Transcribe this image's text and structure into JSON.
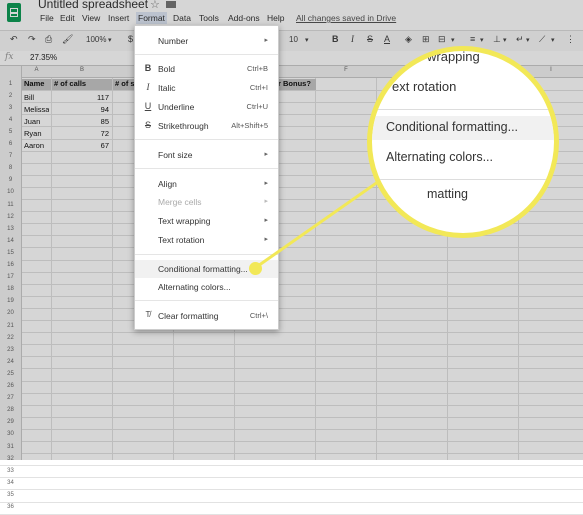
{
  "app": {
    "doc_title": "Untitled spreadsheet",
    "saved_status": "All changes saved in Drive",
    "menus": [
      "File",
      "Edit",
      "View",
      "Insert",
      "Format",
      "Data",
      "Tools",
      "Add-ons",
      "Help"
    ]
  },
  "toolbar": {
    "zoom": "100%",
    "currency": "$",
    "font_size": "10"
  },
  "formula_bar": {
    "fx": "fx",
    "value": "27.35%"
  },
  "grid": {
    "columns": [
      "A",
      "B",
      "C",
      "D",
      "E",
      "F",
      "G",
      "H",
      "I"
    ],
    "rows": [
      "1",
      "2",
      "3",
      "4",
      "5",
      "6",
      "7",
      "8",
      "9",
      "10",
      "11",
      "12",
      "13",
      "14",
      "15",
      "16",
      "17",
      "18",
      "19",
      "20",
      "21",
      "22",
      "23",
      "24",
      "25",
      "26",
      "27",
      "28",
      "29",
      "30",
      "31",
      "32",
      "33",
      "34",
      "35",
      "36"
    ],
    "header_row": {
      "name": "Name",
      "calls": "# of calls",
      "c_partial": "# of s",
      "e_partial": "r Bonus?"
    },
    "data": [
      {
        "name": "Bill",
        "calls": "117"
      },
      {
        "name": "Melissa",
        "calls": "94"
      },
      {
        "name": "Juan",
        "calls": "85"
      },
      {
        "name": "Ryan",
        "calls": "72"
      },
      {
        "name": "Aaron",
        "calls": "67"
      }
    ]
  },
  "format_menu": {
    "number": "Number",
    "bold": "Bold",
    "bold_sc": "Ctrl+B",
    "italic": "Italic",
    "italic_sc": "Ctrl+I",
    "underline": "Underline",
    "underline_sc": "Ctrl+U",
    "strikethrough": "Strikethrough",
    "strikethrough_sc": "Alt+Shift+5",
    "font_size": "Font size",
    "align": "Align",
    "merge_cells": "Merge cells",
    "text_wrapping": "Text wrapping",
    "text_rotation": "Text rotation",
    "conditional_formatting": "Conditional formatting...",
    "alternating_colors": "Alternating colors...",
    "clear_formatting": "Clear formatting",
    "clear_formatting_sc": "Ctrl+\\"
  },
  "magnifier": {
    "wrapping_partial": "wrapping",
    "rotation_partial": "ext rotation",
    "conditional": "Conditional formatting...",
    "alternating": "Alternating colors...",
    "clear_partial": "matting"
  },
  "colors": {
    "callout": "#f2e857",
    "logo": "#0f9d58"
  }
}
